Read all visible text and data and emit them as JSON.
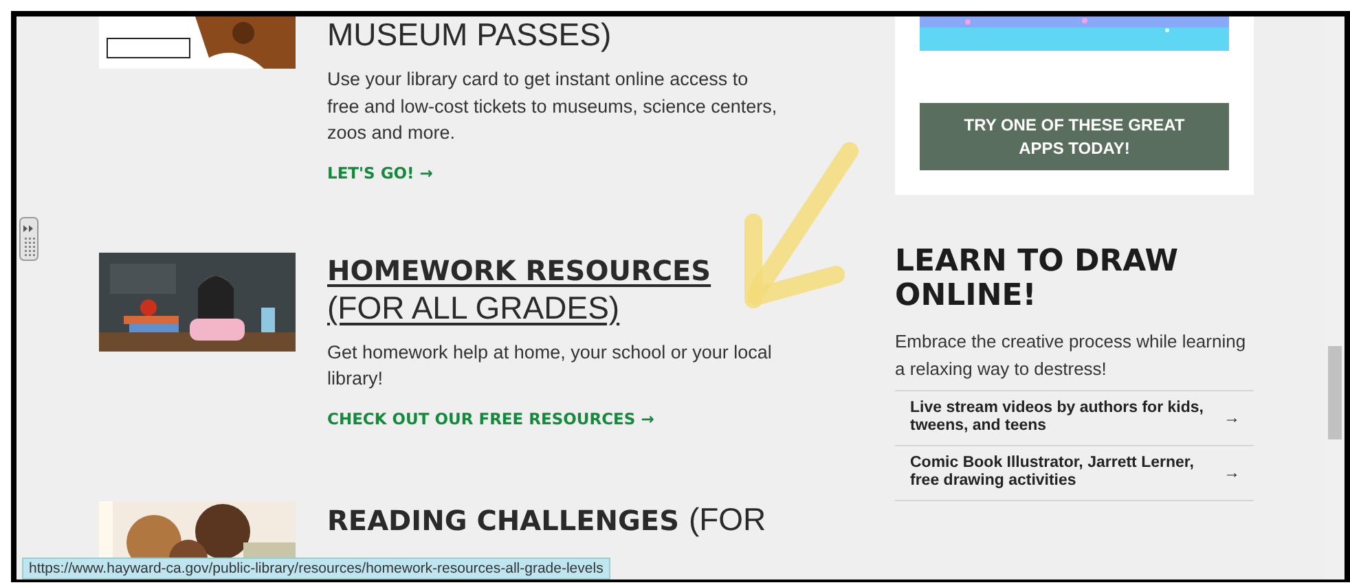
{
  "articles": [
    {
      "heading_light": "MUSEUM PASSES)",
      "underlined": false,
      "description": "Use your library card to get instant online access to free and low-cost tickets to museums, science centers, zoos and more.",
      "link": "LET'S GO!"
    },
    {
      "heading_bold": "HOMEWORK RESOURCES",
      "heading_light": "(FOR ALL GRADES)",
      "underlined": true,
      "description": "Get homework help at home, your school or your local library!",
      "link": "CHECK OUT OUR FREE RESOURCES"
    },
    {
      "heading_bold": "READING CHALLENGES",
      "heading_light": "(FOR",
      "underlined": false
    }
  ],
  "apps_card": {
    "button": "TRY ONE OF THESE GREAT APPS TODAY!"
  },
  "draw_section": {
    "title": "LEARN TO DRAW ONLINE!",
    "description": "Embrace the creative process while learning a relaxing way to destress!",
    "links": [
      {
        "label": "Live stream videos by authors for kids, tweens, and teens",
        "arrow": "→"
      },
      {
        "label": "Comic Book Illustrator, Jarrett Lerner, free drawing activities",
        "arrow": "→"
      }
    ]
  },
  "status_bar": {
    "url": "https://www.hayward-ca.gov/public-library/resources/homework-resources-all-grade-levels"
  }
}
